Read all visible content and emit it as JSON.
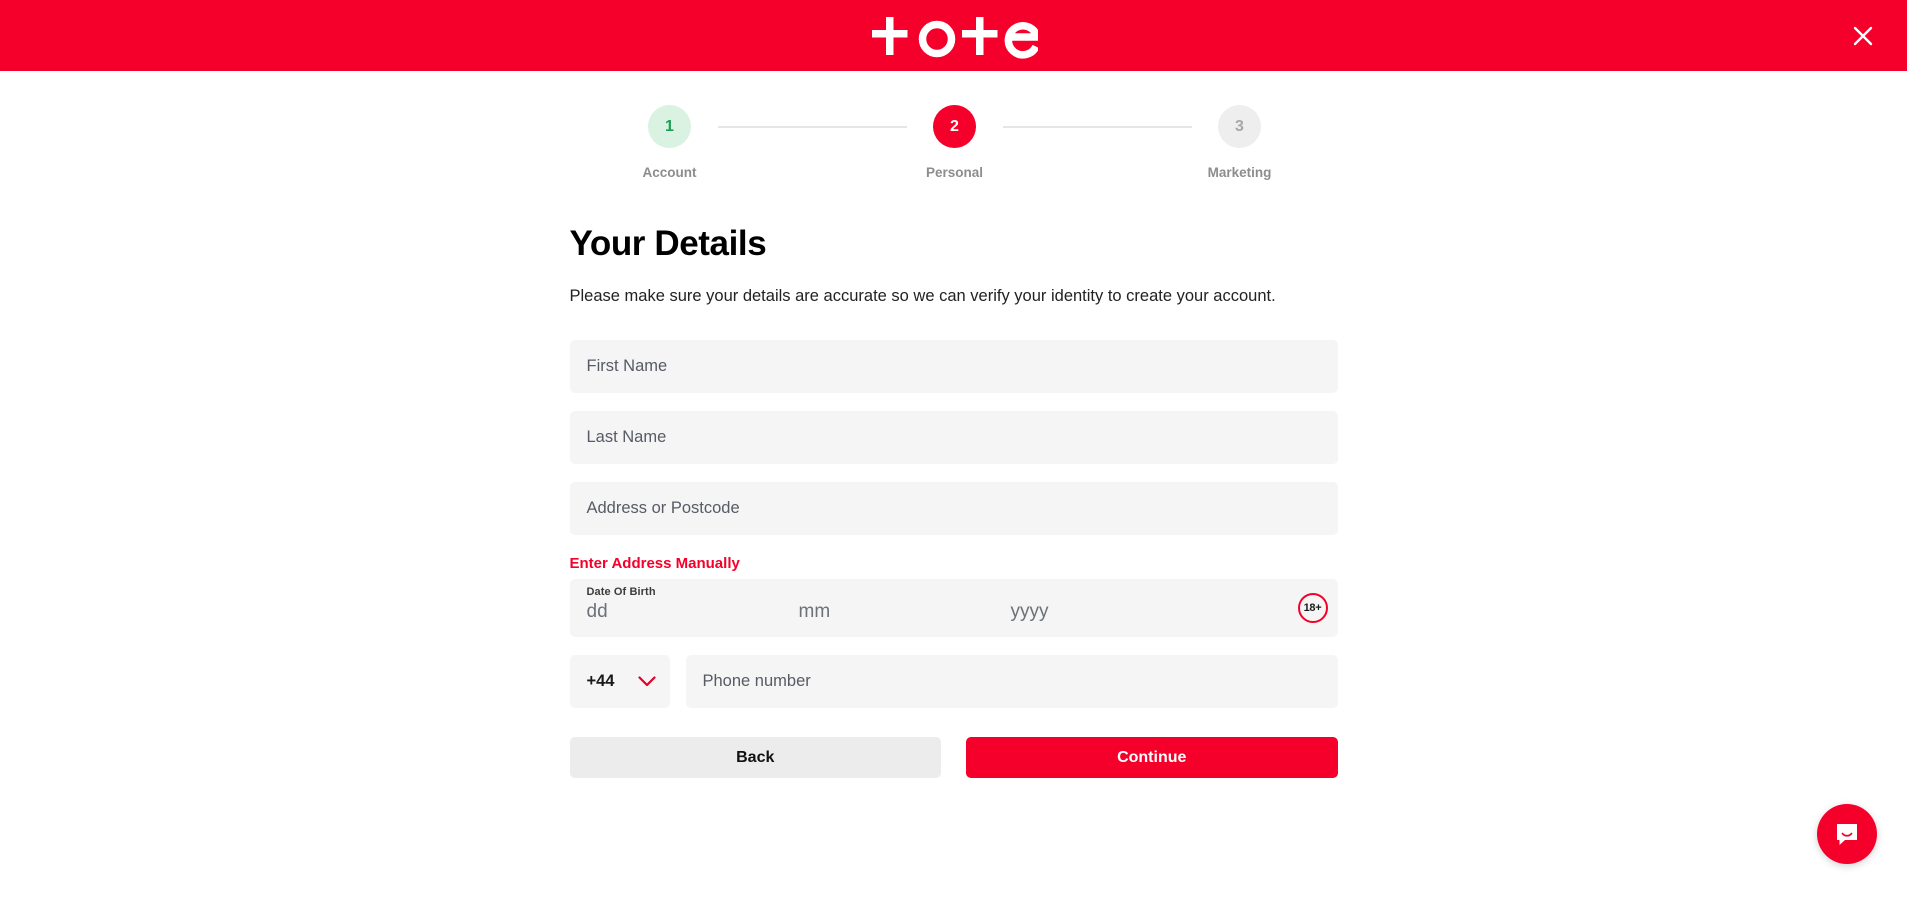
{
  "header": {
    "logo_text": "tote",
    "logo_icon": "tote-wordmark",
    "close_icon": "close-icon",
    "background_color": "#f5002a"
  },
  "stepper": {
    "steps": [
      {
        "number": "1",
        "label": "Account",
        "state": "done"
      },
      {
        "number": "2",
        "label": "Personal",
        "state": "active"
      },
      {
        "number": "3",
        "label": "Marketing",
        "state": "todo"
      }
    ]
  },
  "main": {
    "title": "Your Details",
    "subtitle": "Please make sure your details are accurate so we can verify your identity to create your account.",
    "fields": {
      "first_name_placeholder": "First Name",
      "last_name_placeholder": "Last Name",
      "address_placeholder": "Address or Postcode",
      "manual_address_link": "Enter Address Manually",
      "dob_label": "Date Of Birth",
      "dob_day_placeholder": "dd",
      "dob_month_placeholder": "mm",
      "dob_year_placeholder": "yyyy",
      "age_badge": "18+",
      "country_code": "+44",
      "country_code_icon": "chevron-down-icon",
      "phone_placeholder": "Phone number"
    },
    "buttons": {
      "back": "Back",
      "continue": "Continue"
    }
  },
  "chat": {
    "icon": "chat-bubble-icon"
  },
  "colors": {
    "brand_red": "#f5002a",
    "done_green_bg": "#d9f2e2",
    "done_green_text": "#1aa053",
    "field_bg": "#f5f5f6",
    "back_btn_bg": "#ececec"
  }
}
